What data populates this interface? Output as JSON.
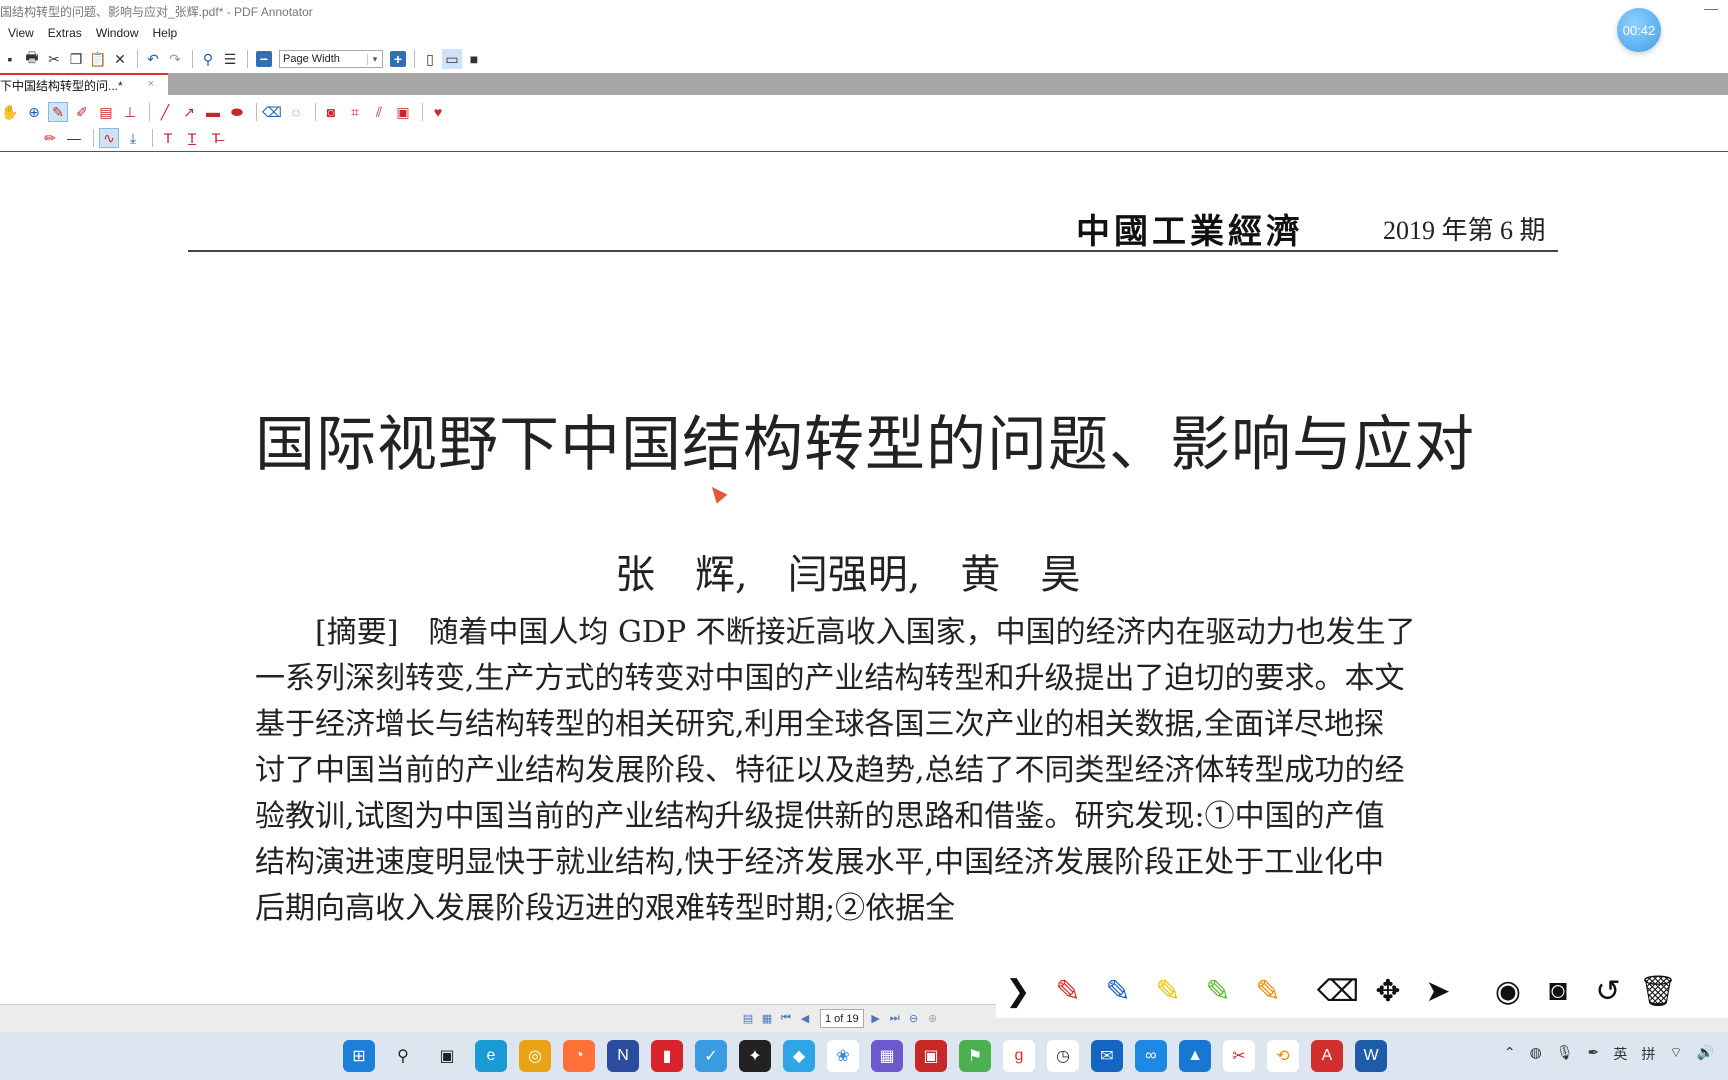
{
  "window": {
    "title": "国结构转型的问题、影响与应对_张辉.pdf* - PDF Annotator",
    "minimize_glyph": "—"
  },
  "timer": "00:42",
  "menu": [
    "View",
    "Extras",
    "Window",
    "Help"
  ],
  "toolbar": {
    "zoom_value": "Page Width",
    "icons": [
      "save-icon",
      "print-icon",
      "cut-icon",
      "copy-icon",
      "paste-icon",
      "delete-icon",
      "undo-icon",
      "redo-icon",
      "find-icon",
      "outline-icon"
    ]
  },
  "tab": {
    "label": "下中国结构转型的问...*",
    "close": "×"
  },
  "document": {
    "journal": "中國工業經濟",
    "issue": "2019 年第 6 期",
    "title": "国际视野下中国结构转型的问题、影响与应对",
    "authors": "张　辉,　闫强明,　黄　昊",
    "abstract_lines": [
      "[摘要]　随着中国人均 GDP 不断接近高收入国家，中国的经济内在驱动力也发生了",
      "一系列深刻转变,生产方式的转变对中国的产业结构转型和升级提出了迫切的要求。本文",
      "基于经济增长与结构转型的相关研究,利用全球各国三次产业的相关数据,全面详尽地探",
      "讨了中国当前的产业结构发展阶段、特征以及趋势,总结了不同类型经济体转型成功的经",
      "验教训,试图为中国当前的产业结构升级提供新的思路和借鉴。研究发现:①中国的产值",
      "结构演进速度明显快于就业结构,快于经济发展水平,中国经济发展阶段正处于工业化中",
      "后期向高收入发展阶段迈进的艰难转型时期;②依据全"
    ]
  },
  "status": {
    "page": "1 of 19"
  },
  "annotate_bar": {
    "colors": {
      "red": "#d32f2f",
      "blue": "#1565c0",
      "yellow": "#f2c200",
      "green": "#5cb82e",
      "orange": "#f08a00"
    }
  },
  "tray": {
    "ime1": "英",
    "ime2": "拼"
  }
}
